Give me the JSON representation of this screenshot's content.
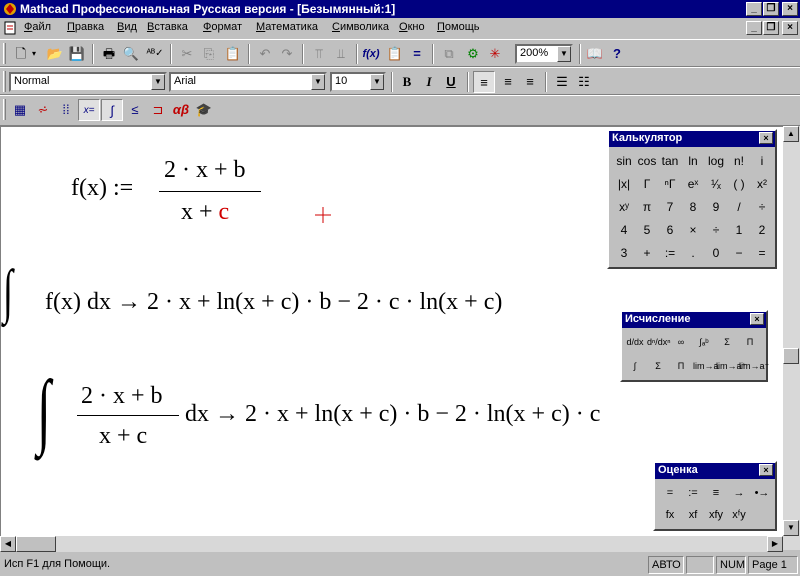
{
  "window": {
    "title": "Mathcad Профессиональная Русская версия - [Безымянный:1]"
  },
  "menu": [
    "Файл",
    "Правка",
    "Вид",
    "Вставка",
    "Формат",
    "Математика",
    "Символика",
    "Окно",
    "Помощь"
  ],
  "toolbar": {
    "zoom": "200%"
  },
  "format_bar": {
    "style": "Normal",
    "font": "Arial",
    "size": "10"
  },
  "worksheet": {
    "def_lhs": "f(x) :=",
    "def_num": "2 · x + b",
    "def_den_a": "x + ",
    "def_den_c": "c",
    "eq1": "f(x) dx → 2 · x + ln(x + c) · b − 2 · c · ln(x + c)",
    "eq2_num": "2 · x + b",
    "eq2_den": "x + c",
    "eq2_rest": "dx → 2 · x + ln(x + c) · b − 2 · ln(x + c) · c"
  },
  "palettes": {
    "calculator": {
      "title": "Калькулятор",
      "rows": [
        [
          "sin",
          "cos",
          "tan",
          "ln",
          "log",
          "n!",
          "i"
        ],
        [
          "|x|",
          "Γ",
          "ⁿΓ",
          "eˣ",
          "¹⁄ₓ",
          "( )",
          "x²"
        ],
        [
          "xʸ",
          "π",
          "7",
          "8",
          "9",
          "/",
          "÷"
        ],
        [
          "4",
          "5",
          "6",
          "×",
          "÷",
          "1",
          "2"
        ],
        [
          "3",
          "+",
          ":=",
          ".",
          "0",
          "−",
          "="
        ]
      ]
    },
    "calculus": {
      "title": "Исчисление",
      "rows": [
        [
          "d/dx",
          "dⁿ/dxⁿ",
          "∞",
          "∫ₐᵇ",
          "Σ",
          "Π"
        ],
        [
          "∫",
          "Σ",
          "Π",
          "lim→a",
          "lim→a⁺",
          "lim→a⁻"
        ]
      ]
    },
    "evaluation": {
      "title": "Оценка",
      "rows": [
        [
          "=",
          ":=",
          "≡",
          "→",
          "•→"
        ],
        [
          "fx",
          "xf",
          "xfy",
          "xᶠy"
        ]
      ]
    }
  },
  "status": {
    "help": "Исп F1 для Помощи.",
    "mode": "АВТО",
    "num": "NUM",
    "page": "Page 1"
  }
}
